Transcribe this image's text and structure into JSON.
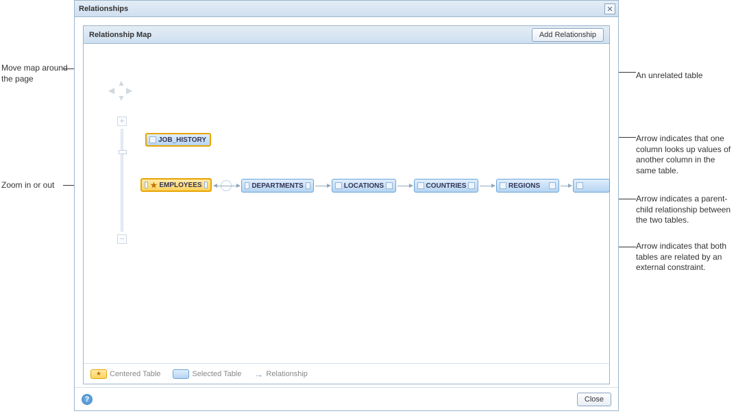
{
  "dialog": {
    "title": "Relationships",
    "close_tooltip": "Close"
  },
  "panel": {
    "title": "Relationship Map",
    "add_button": "Add Relationship"
  },
  "tables": {
    "job_history": "JOB_HISTORY",
    "employees": "EMPLOYEES",
    "departments": "DEPARTMENTS",
    "locations": "LOCATIONS",
    "countries": "COUNTRIES",
    "regions": "REGIONS"
  },
  "legend": {
    "centered": "Centered Table",
    "selected": "Selected Table",
    "relationship": "Relationship"
  },
  "footer": {
    "close": "Close"
  },
  "annotations": {
    "move_map": "Move map around the page",
    "zoom": "Zoom in or out",
    "unrelated": "An unrelated table",
    "self_lookup": "Arrow indicates that one column looks up values of another column in the same table.",
    "parent_child": "Arrow indicates a parent-child relationship between the two tables.",
    "external": "Arrow indicates that both tables are related by an external constraint."
  }
}
